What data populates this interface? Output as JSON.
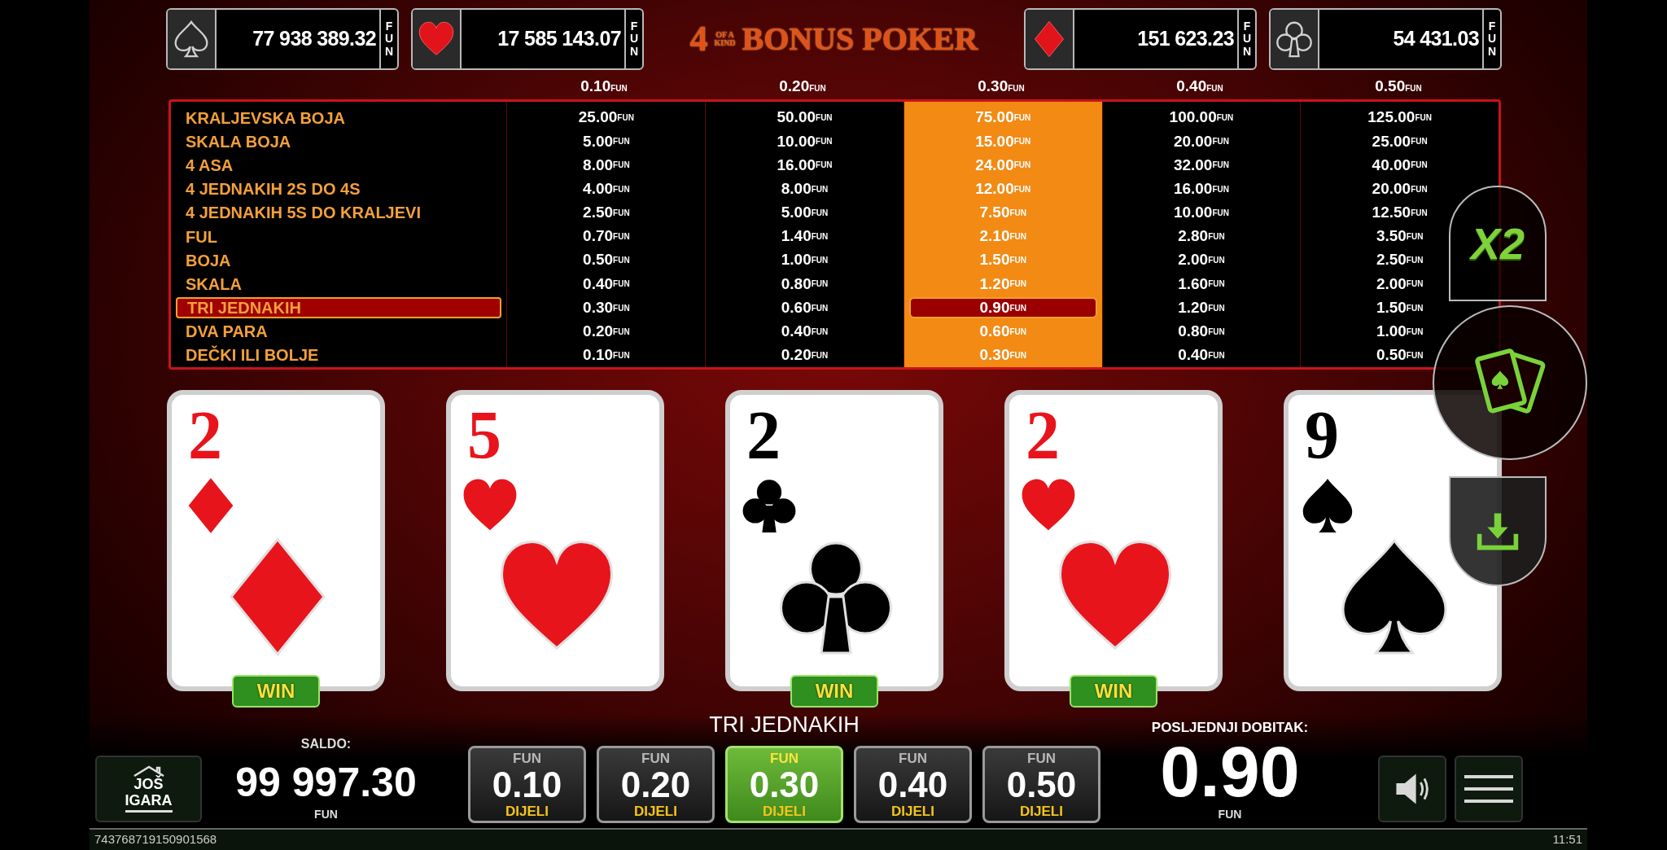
{
  "jackpots": [
    {
      "kind": "spade",
      "amount": "77 938 389.32",
      "unit": "FUN"
    },
    {
      "kind": "heart",
      "amount": "17 585 143.07",
      "unit": "FUN"
    },
    {
      "kind": "diamond",
      "amount": "151 623.23",
      "unit": "FUN"
    },
    {
      "kind": "club",
      "amount": "54 431.03",
      "unit": "FUN"
    }
  ],
  "title": {
    "number": "4",
    "small": "OF A KIND",
    "main": "BONUS POKER"
  },
  "paytable": {
    "columns": [
      {
        "bet": "0.10",
        "unit": "FUN",
        "selected": false
      },
      {
        "bet": "0.20",
        "unit": "FUN",
        "selected": false
      },
      {
        "bet": "0.30",
        "unit": "FUN",
        "selected": true
      },
      {
        "bet": "0.40",
        "unit": "FUN",
        "selected": false
      },
      {
        "bet": "0.50",
        "unit": "FUN",
        "selected": false
      }
    ],
    "rows": [
      {
        "hand": "KRALJEVSKA BOJA",
        "selected": false,
        "payouts": [
          {
            "value": "25.00",
            "unit": "FUN"
          },
          {
            "value": "50.00",
            "unit": "FUN"
          },
          {
            "value": "75.00",
            "unit": "FUN"
          },
          {
            "value": "100.00",
            "unit": "FUN"
          },
          {
            "value": "125.00",
            "unit": "FUN"
          }
        ]
      },
      {
        "hand": "SKALA BOJA",
        "selected": false,
        "payouts": [
          {
            "value": "5.00",
            "unit": "FUN"
          },
          {
            "value": "10.00",
            "unit": "FUN"
          },
          {
            "value": "15.00",
            "unit": "FUN"
          },
          {
            "value": "20.00",
            "unit": "FUN"
          },
          {
            "value": "25.00",
            "unit": "FUN"
          }
        ]
      },
      {
        "hand": "4 ASA",
        "selected": false,
        "payouts": [
          {
            "value": "8.00",
            "unit": "FUN"
          },
          {
            "value": "16.00",
            "unit": "FUN"
          },
          {
            "value": "24.00",
            "unit": "FUN"
          },
          {
            "value": "32.00",
            "unit": "FUN"
          },
          {
            "value": "40.00",
            "unit": "FUN"
          }
        ]
      },
      {
        "hand": "4 JEDNAKIH 2S DO 4S",
        "selected": false,
        "payouts": [
          {
            "value": "4.00",
            "unit": "FUN"
          },
          {
            "value": "8.00",
            "unit": "FUN"
          },
          {
            "value": "12.00",
            "unit": "FUN"
          },
          {
            "value": "16.00",
            "unit": "FUN"
          },
          {
            "value": "20.00",
            "unit": "FUN"
          }
        ]
      },
      {
        "hand": "4 JEDNAKIH 5S DO KRALJEVI",
        "selected": false,
        "payouts": [
          {
            "value": "2.50",
            "unit": "FUN"
          },
          {
            "value": "5.00",
            "unit": "FUN"
          },
          {
            "value": "7.50",
            "unit": "FUN"
          },
          {
            "value": "10.00",
            "unit": "FUN"
          },
          {
            "value": "12.50",
            "unit": "FUN"
          }
        ]
      },
      {
        "hand": "FUL",
        "selected": false,
        "payouts": [
          {
            "value": "0.70",
            "unit": "FUN"
          },
          {
            "value": "1.40",
            "unit": "FUN"
          },
          {
            "value": "2.10",
            "unit": "FUN"
          },
          {
            "value": "2.80",
            "unit": "FUN"
          },
          {
            "value": "3.50",
            "unit": "FUN"
          }
        ]
      },
      {
        "hand": "BOJA",
        "selected": false,
        "payouts": [
          {
            "value": "0.50",
            "unit": "FUN"
          },
          {
            "value": "1.00",
            "unit": "FUN"
          },
          {
            "value": "1.50",
            "unit": "FUN"
          },
          {
            "value": "2.00",
            "unit": "FUN"
          },
          {
            "value": "2.50",
            "unit": "FUN"
          }
        ]
      },
      {
        "hand": "SKALA",
        "selected": false,
        "payouts": [
          {
            "value": "0.40",
            "unit": "FUN"
          },
          {
            "value": "0.80",
            "unit": "FUN"
          },
          {
            "value": "1.20",
            "unit": "FUN"
          },
          {
            "value": "1.60",
            "unit": "FUN"
          },
          {
            "value": "2.00",
            "unit": "FUN"
          }
        ]
      },
      {
        "hand": "TRI JEDNAKIH",
        "selected": true,
        "payouts": [
          {
            "value": "0.30",
            "unit": "FUN"
          },
          {
            "value": "0.60",
            "unit": "FUN"
          },
          {
            "value": "0.90",
            "unit": "FUN"
          },
          {
            "value": "1.20",
            "unit": "FUN"
          },
          {
            "value": "1.50",
            "unit": "FUN"
          }
        ]
      },
      {
        "hand": "DVA PARA",
        "selected": false,
        "payouts": [
          {
            "value": "0.20",
            "unit": "FUN"
          },
          {
            "value": "0.40",
            "unit": "FUN"
          },
          {
            "value": "0.60",
            "unit": "FUN"
          },
          {
            "value": "0.80",
            "unit": "FUN"
          },
          {
            "value": "1.00",
            "unit": "FUN"
          }
        ]
      },
      {
        "hand": "DEČKI ILI BOLJE",
        "selected": false,
        "payouts": [
          {
            "value": "0.10",
            "unit": "FUN"
          },
          {
            "value": "0.20",
            "unit": "FUN"
          },
          {
            "value": "0.30",
            "unit": "FUN"
          },
          {
            "value": "0.40",
            "unit": "FUN"
          },
          {
            "value": "0.50",
            "unit": "FUN"
          }
        ]
      }
    ]
  },
  "cards": [
    {
      "rank": "2",
      "kind": "diamond",
      "badge": "WIN"
    },
    {
      "rank": "5",
      "kind": "heart"
    },
    {
      "rank": "2",
      "kind": "club",
      "badge": "WIN"
    },
    {
      "rank": "2",
      "kind": "heart",
      "badge": "WIN"
    },
    {
      "rank": "9",
      "kind": "spade"
    }
  ],
  "side_buttons": {
    "double": "X2"
  },
  "home_button": {
    "line1": "JOŠ",
    "line2": "IGARA"
  },
  "balance": {
    "label": "SALDO:",
    "amount": "99 997.30",
    "unit": "FUN"
  },
  "result": "TRI JEDNAKIH",
  "bet_buttons": [
    {
      "unit": "FUN",
      "amount": "0.10",
      "action": "DIJELI",
      "selected": false
    },
    {
      "unit": "FUN",
      "amount": "0.20",
      "action": "DIJELI",
      "selected": false
    },
    {
      "unit": "FUN",
      "amount": "0.30",
      "action": "DIJELI",
      "selected": true
    },
    {
      "unit": "FUN",
      "amount": "0.40",
      "action": "DIJELI",
      "selected": false
    },
    {
      "unit": "FUN",
      "amount": "0.50",
      "action": "DIJELI",
      "selected": false
    }
  ],
  "last_win": {
    "label": "POSLJEDNJI DOBITAK:",
    "amount": "0.90",
    "unit": "FUN"
  },
  "status_bar": {
    "id": "743768719150901568",
    "time": "11:51"
  }
}
